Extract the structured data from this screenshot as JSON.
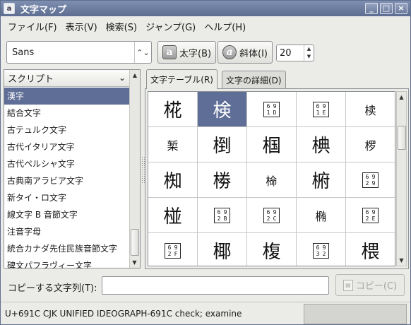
{
  "window": {
    "title": "文字マップ",
    "app_icon": "a",
    "controls": {
      "minimize": "_",
      "maximize": "□",
      "close": "×"
    }
  },
  "menu": [
    {
      "label": "ファイル(F)"
    },
    {
      "label": "表示(V)"
    },
    {
      "label": "検索(S)"
    },
    {
      "label": "ジャンプ(G)"
    },
    {
      "label": "ヘルプ(H)"
    }
  ],
  "toolbar": {
    "font_name": "Sans",
    "bold_label": "太字(B)",
    "bold_icon_glyph": "a",
    "italic_label": "斜体(I)",
    "italic_icon_glyph": "a",
    "size_value": "20"
  },
  "script_panel": {
    "header": "スクリプト",
    "items": [
      {
        "label": "漢字",
        "selected": true
      },
      {
        "label": "結合文字"
      },
      {
        "label": "古テュルク文字"
      },
      {
        "label": "古代イタリア文字"
      },
      {
        "label": "古代ペルシャ文字"
      },
      {
        "label": "古典南アラビア文字"
      },
      {
        "label": "新タイ・ロ文字"
      },
      {
        "label": "線文字 B 音節文字"
      },
      {
        "label": "注音字母"
      },
      {
        "label": "統合カナダ先住民族音節文字"
      },
      {
        "label": "碑文パフラヴィー文字"
      }
    ]
  },
  "tabs": [
    {
      "label": "文字テーブル(R)",
      "active": true
    },
    {
      "label": "文字の詳細(D)",
      "active": false
    }
  ],
  "char_grid": [
    {
      "char": "椛"
    },
    {
      "char": "検",
      "selected": true
    },
    {
      "hex": [
        "69",
        "1D"
      ]
    },
    {
      "hex": [
        "69",
        "1E"
      ]
    },
    {
      "char": "椟",
      "small": true
    },
    {
      "char": "椠",
      "small": true
    },
    {
      "char": "椡"
    },
    {
      "char": "椢"
    },
    {
      "char": "椣"
    },
    {
      "char": "椤",
      "small": true
    },
    {
      "char": "椥"
    },
    {
      "char": "椦"
    },
    {
      "char": "椧",
      "small": true
    },
    {
      "char": "椨"
    },
    {
      "hex": [
        "69",
        "29"
      ]
    },
    {
      "char": "椪"
    },
    {
      "hex": [
        "69",
        "2B"
      ]
    },
    {
      "hex": [
        "69",
        "2C"
      ]
    },
    {
      "char": "椭",
      "small": true
    },
    {
      "hex": [
        "69",
        "2E"
      ]
    },
    {
      "hex": [
        "69",
        "2F"
      ]
    },
    {
      "char": "椰"
    },
    {
      "char": "椱"
    },
    {
      "hex": [
        "69",
        "32"
      ]
    },
    {
      "char": "椳"
    }
  ],
  "copy": {
    "label": "コピーする文字列(T):",
    "value": "",
    "button_label": "コピー(C)"
  },
  "status": {
    "text": "U+691C CJK UNIFIED IDEOGRAPH-691C   check; examine"
  },
  "colors": {
    "selection": "#5f6e97",
    "titlebar": "#6e7ea2",
    "window_bg": "#ebebe7"
  }
}
